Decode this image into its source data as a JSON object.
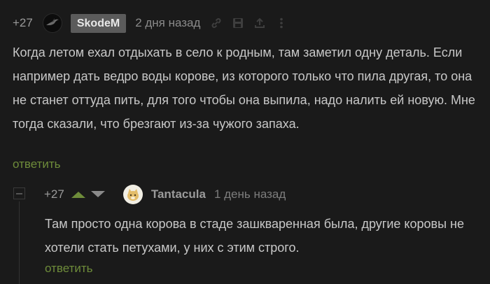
{
  "comment": {
    "rating": "+27",
    "author": "SkodeM",
    "time": "2 дня назад",
    "text": "Когда летом ехал отдыхать в село к родным, там заметил одну деталь. Если например дать ведро воды корове, из которого только что пила другая, то она не станет оттуда пить, для того чтобы она выпила, надо налить ей новую. Мне тогда сказали, что брезгают из-за чужого запаха.",
    "reply_label": "ответить",
    "icons": [
      "link-icon",
      "save-icon",
      "share-icon",
      "more-icon"
    ]
  },
  "reply": {
    "rating": "+27",
    "author": "Tantacula",
    "time": "1 день назад",
    "text": "Там просто одна корова в стаде зашкваренная была, другие коровы не хотели стать петухами, у них с этим строго.",
    "reply_label": "ответить"
  },
  "colors": {
    "background": "#1a1a1a",
    "text": "#c8c8c8",
    "muted": "#8a8a8a",
    "reply_link": "#6e8c3a",
    "vote_up": "#6e8c3a",
    "vote_down": "#8a8a8a",
    "author_badge": "#5b5b5b"
  }
}
